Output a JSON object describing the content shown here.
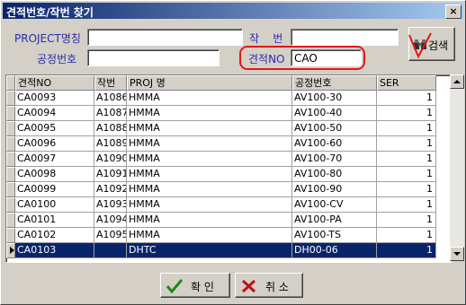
{
  "window": {
    "title": "견적번호/작번 찾기",
    "close_glyph": "×"
  },
  "filters": {
    "project_label": "PROJECT명칭",
    "project_value": "",
    "jakbun_label": "작    번",
    "jakbun_value": "",
    "process_label": "공정번호",
    "process_value": "",
    "estimate_label": "견적NO",
    "estimate_value": "CAO"
  },
  "search_button": {
    "label": "검색",
    "icon": "binoculars-icon"
  },
  "grid": {
    "columns": [
      "견적NO",
      "작번",
      "PROJ 명",
      "공정번호",
      "SER"
    ],
    "rows": [
      [
        "CA0093",
        "A1086",
        "HMMA",
        "AV100-30",
        "1"
      ],
      [
        "CA0094",
        "A1087",
        "HMMA",
        "AV100-40",
        "1"
      ],
      [
        "CA0095",
        "A1088",
        "HMMA",
        "AV100-50",
        "1"
      ],
      [
        "CA0096",
        "A1089",
        "HMMA",
        "AV100-60",
        "1"
      ],
      [
        "CA0097",
        "A1090",
        "HMMA",
        "AV100-70",
        "1"
      ],
      [
        "CA0098",
        "A1091",
        "HMMA",
        "AV100-80",
        "1"
      ],
      [
        "CA0099",
        "A1092",
        "HMMA",
        "AV100-90",
        "1"
      ],
      [
        "CA0100",
        "A1093",
        "HMMA",
        "AV100-CV",
        "1"
      ],
      [
        "CA0101",
        "A1094",
        "HMMA",
        "AV100-PA",
        "1"
      ],
      [
        "CA0102",
        "A1095",
        "HMMA",
        "AV100-TS",
        "1"
      ],
      [
        "CA0103",
        "",
        "DHTC",
        "DH00-06",
        "1"
      ]
    ],
    "selected_row": 10
  },
  "buttons": {
    "ok_label": "확 인",
    "cancel_label": "취 소"
  },
  "colors": {
    "selection": "#0a246a",
    "annotation": "#e01818",
    "label_blue": "#2a2aa8"
  }
}
